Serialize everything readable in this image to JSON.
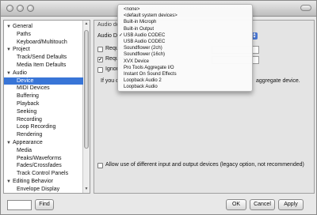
{
  "sidebar": {
    "items": [
      {
        "label": "General",
        "type": "category"
      },
      {
        "label": "Paths",
        "type": "child"
      },
      {
        "label": "Keyboard/Multitouch",
        "type": "child"
      },
      {
        "label": "Project",
        "type": "category"
      },
      {
        "label": "Track/Send Defaults",
        "type": "child"
      },
      {
        "label": "Media Item Defaults",
        "type": "child"
      },
      {
        "label": "Audio",
        "type": "category"
      },
      {
        "label": "Device",
        "type": "child",
        "selected": true
      },
      {
        "label": "MIDI Devices",
        "type": "child"
      },
      {
        "label": "Buffering",
        "type": "child"
      },
      {
        "label": "Playback",
        "type": "child"
      },
      {
        "label": "Seeking",
        "type": "child"
      },
      {
        "label": "Recording",
        "type": "child"
      },
      {
        "label": "Loop Recording",
        "type": "child"
      },
      {
        "label": "Rendering",
        "type": "child"
      },
      {
        "label": "Appearance",
        "type": "category"
      },
      {
        "label": "Media",
        "type": "child"
      },
      {
        "label": "Peaks/Waveforms",
        "type": "child"
      },
      {
        "label": "Fades/Crossfades",
        "type": "child"
      },
      {
        "label": "Track Control Panels",
        "type": "child"
      },
      {
        "label": "Editing Behavior",
        "type": "category"
      },
      {
        "label": "Envelope Display",
        "type": "child"
      }
    ]
  },
  "main": {
    "section_title": "Audio devi",
    "device_label": "Audio Device:",
    "request_sample_label": "Request sa",
    "request_block_label": "Request blo",
    "ignore_label": "Ignore runn",
    "if_you_text": "If you c",
    "aggregate_text": "aggregate device.",
    "allow_label": "Allow use of different input and output devices (legacy option, not recommended)"
  },
  "menu": {
    "items": [
      {
        "label": "<none>",
        "checked": false
      },
      {
        "label": "<default system devices>",
        "checked": false
      },
      {
        "label": "Built-in Microph",
        "checked": false
      },
      {
        "label": "Built-in Output",
        "checked": false
      },
      {
        "label": "USB Audio CODEC",
        "checked": true
      },
      {
        "label": "USB Audio CODEC",
        "checked": false
      },
      {
        "label": "Soundflower (2ch)",
        "checked": false
      },
      {
        "label": "Soundflower (16ch)",
        "checked": false
      },
      {
        "label": "XVX Device",
        "checked": false
      },
      {
        "label": "Pro Tools Aggregate I/O",
        "checked": false
      },
      {
        "label": "Instant On Sound Effects",
        "checked": false
      },
      {
        "label": "Loopback Audio 2",
        "checked": false
      },
      {
        "label": "Loopback Audio",
        "checked": false
      }
    ],
    "check_glyph": "✓"
  },
  "footer": {
    "find_label": "Find",
    "ok_label": "OK",
    "cancel_label": "Cancel",
    "apply_label": "Apply"
  }
}
